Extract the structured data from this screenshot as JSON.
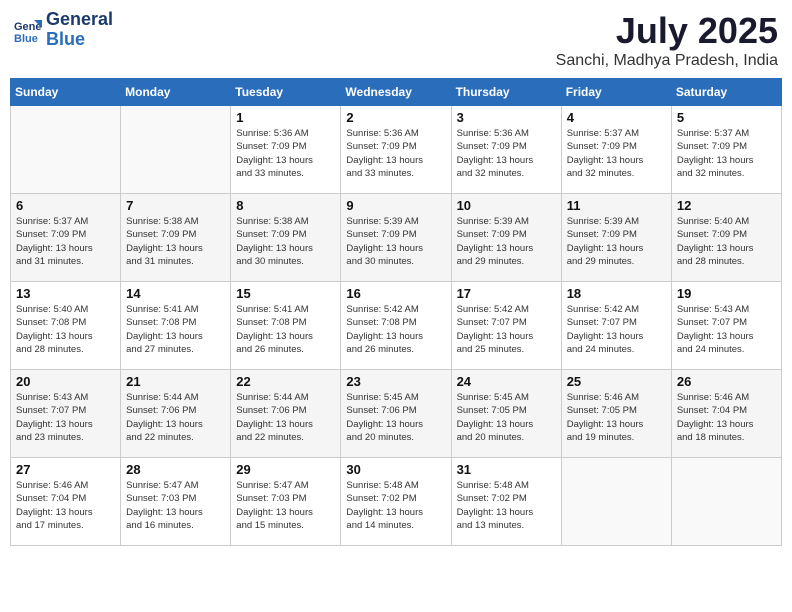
{
  "header": {
    "logo_line1": "General",
    "logo_line2": "Blue",
    "month_year": "July 2025",
    "location": "Sanchi, Madhya Pradesh, India"
  },
  "weekdays": [
    "Sunday",
    "Monday",
    "Tuesday",
    "Wednesday",
    "Thursday",
    "Friday",
    "Saturday"
  ],
  "weeks": [
    [
      {
        "day": "",
        "lines": [],
        "empty": true
      },
      {
        "day": "",
        "lines": [],
        "empty": true
      },
      {
        "day": "1",
        "lines": [
          "Sunrise: 5:36 AM",
          "Sunset: 7:09 PM",
          "Daylight: 13 hours",
          "and 33 minutes."
        ]
      },
      {
        "day": "2",
        "lines": [
          "Sunrise: 5:36 AM",
          "Sunset: 7:09 PM",
          "Daylight: 13 hours",
          "and 33 minutes."
        ]
      },
      {
        "day": "3",
        "lines": [
          "Sunrise: 5:36 AM",
          "Sunset: 7:09 PM",
          "Daylight: 13 hours",
          "and 32 minutes."
        ]
      },
      {
        "day": "4",
        "lines": [
          "Sunrise: 5:37 AM",
          "Sunset: 7:09 PM",
          "Daylight: 13 hours",
          "and 32 minutes."
        ]
      },
      {
        "day": "5",
        "lines": [
          "Sunrise: 5:37 AM",
          "Sunset: 7:09 PM",
          "Daylight: 13 hours",
          "and 32 minutes."
        ]
      }
    ],
    [
      {
        "day": "6",
        "lines": [
          "Sunrise: 5:37 AM",
          "Sunset: 7:09 PM",
          "Daylight: 13 hours",
          "and 31 minutes."
        ]
      },
      {
        "day": "7",
        "lines": [
          "Sunrise: 5:38 AM",
          "Sunset: 7:09 PM",
          "Daylight: 13 hours",
          "and 31 minutes."
        ]
      },
      {
        "day": "8",
        "lines": [
          "Sunrise: 5:38 AM",
          "Sunset: 7:09 PM",
          "Daylight: 13 hours",
          "and 30 minutes."
        ]
      },
      {
        "day": "9",
        "lines": [
          "Sunrise: 5:39 AM",
          "Sunset: 7:09 PM",
          "Daylight: 13 hours",
          "and 30 minutes."
        ]
      },
      {
        "day": "10",
        "lines": [
          "Sunrise: 5:39 AM",
          "Sunset: 7:09 PM",
          "Daylight: 13 hours",
          "and 29 minutes."
        ]
      },
      {
        "day": "11",
        "lines": [
          "Sunrise: 5:39 AM",
          "Sunset: 7:09 PM",
          "Daylight: 13 hours",
          "and 29 minutes."
        ]
      },
      {
        "day": "12",
        "lines": [
          "Sunrise: 5:40 AM",
          "Sunset: 7:09 PM",
          "Daylight: 13 hours",
          "and 28 minutes."
        ]
      }
    ],
    [
      {
        "day": "13",
        "lines": [
          "Sunrise: 5:40 AM",
          "Sunset: 7:08 PM",
          "Daylight: 13 hours",
          "and 28 minutes."
        ]
      },
      {
        "day": "14",
        "lines": [
          "Sunrise: 5:41 AM",
          "Sunset: 7:08 PM",
          "Daylight: 13 hours",
          "and 27 minutes."
        ]
      },
      {
        "day": "15",
        "lines": [
          "Sunrise: 5:41 AM",
          "Sunset: 7:08 PM",
          "Daylight: 13 hours",
          "and 26 minutes."
        ]
      },
      {
        "day": "16",
        "lines": [
          "Sunrise: 5:42 AM",
          "Sunset: 7:08 PM",
          "Daylight: 13 hours",
          "and 26 minutes."
        ]
      },
      {
        "day": "17",
        "lines": [
          "Sunrise: 5:42 AM",
          "Sunset: 7:07 PM",
          "Daylight: 13 hours",
          "and 25 minutes."
        ]
      },
      {
        "day": "18",
        "lines": [
          "Sunrise: 5:42 AM",
          "Sunset: 7:07 PM",
          "Daylight: 13 hours",
          "and 24 minutes."
        ]
      },
      {
        "day": "19",
        "lines": [
          "Sunrise: 5:43 AM",
          "Sunset: 7:07 PM",
          "Daylight: 13 hours",
          "and 24 minutes."
        ]
      }
    ],
    [
      {
        "day": "20",
        "lines": [
          "Sunrise: 5:43 AM",
          "Sunset: 7:07 PM",
          "Daylight: 13 hours",
          "and 23 minutes."
        ]
      },
      {
        "day": "21",
        "lines": [
          "Sunrise: 5:44 AM",
          "Sunset: 7:06 PM",
          "Daylight: 13 hours",
          "and 22 minutes."
        ]
      },
      {
        "day": "22",
        "lines": [
          "Sunrise: 5:44 AM",
          "Sunset: 7:06 PM",
          "Daylight: 13 hours",
          "and 22 minutes."
        ]
      },
      {
        "day": "23",
        "lines": [
          "Sunrise: 5:45 AM",
          "Sunset: 7:06 PM",
          "Daylight: 13 hours",
          "and 20 minutes."
        ]
      },
      {
        "day": "24",
        "lines": [
          "Sunrise: 5:45 AM",
          "Sunset: 7:05 PM",
          "Daylight: 13 hours",
          "and 20 minutes."
        ]
      },
      {
        "day": "25",
        "lines": [
          "Sunrise: 5:46 AM",
          "Sunset: 7:05 PM",
          "Daylight: 13 hours",
          "and 19 minutes."
        ]
      },
      {
        "day": "26",
        "lines": [
          "Sunrise: 5:46 AM",
          "Sunset: 7:04 PM",
          "Daylight: 13 hours",
          "and 18 minutes."
        ]
      }
    ],
    [
      {
        "day": "27",
        "lines": [
          "Sunrise: 5:46 AM",
          "Sunset: 7:04 PM",
          "Daylight: 13 hours",
          "and 17 minutes."
        ]
      },
      {
        "day": "28",
        "lines": [
          "Sunrise: 5:47 AM",
          "Sunset: 7:03 PM",
          "Daylight: 13 hours",
          "and 16 minutes."
        ]
      },
      {
        "day": "29",
        "lines": [
          "Sunrise: 5:47 AM",
          "Sunset: 7:03 PM",
          "Daylight: 13 hours",
          "and 15 minutes."
        ]
      },
      {
        "day": "30",
        "lines": [
          "Sunrise: 5:48 AM",
          "Sunset: 7:02 PM",
          "Daylight: 13 hours",
          "and 14 minutes."
        ]
      },
      {
        "day": "31",
        "lines": [
          "Sunrise: 5:48 AM",
          "Sunset: 7:02 PM",
          "Daylight: 13 hours",
          "and 13 minutes."
        ]
      },
      {
        "day": "",
        "lines": [],
        "empty": true
      },
      {
        "day": "",
        "lines": [],
        "empty": true
      }
    ]
  ]
}
